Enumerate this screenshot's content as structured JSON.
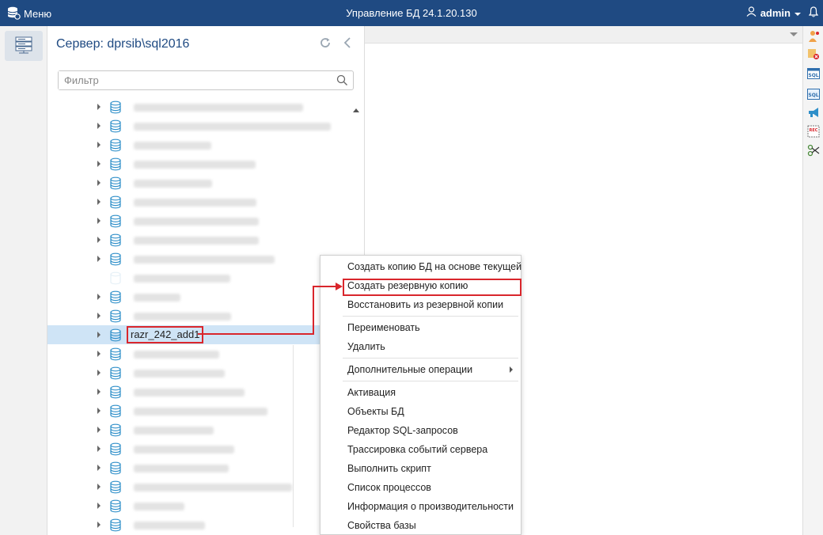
{
  "topbar": {
    "menu_label": "Меню",
    "title": "Управление БД 24.1.20.130",
    "user": "admin"
  },
  "server_panel": {
    "title": "Сервер: dprsib\\sql2016",
    "filter_placeholder": "Фильтр"
  },
  "tree": {
    "selected_db": "razr_242_add1"
  },
  "context_menu": {
    "items": [
      "Создать копию БД на основе текущей",
      "Создать резервную копию",
      "Восстановить из резервной копии",
      "Переименовать",
      "Удалить",
      "Дополнительные операции",
      "Активация",
      "Объекты БД",
      "Редактор SQL-запросов",
      "Трассировка событий сервера",
      "Выполнить скрипт",
      "Список процессов",
      "Информация о производительности",
      "Свойства базы"
    ]
  },
  "colors": {
    "topbar": "#1f4a82",
    "accent": "#1f4a82",
    "highlight_red": "#d9262c",
    "selection": "#cfe4f6"
  }
}
